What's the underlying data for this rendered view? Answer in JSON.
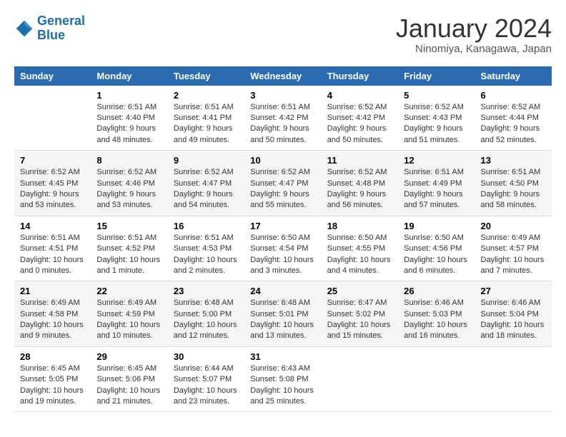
{
  "header": {
    "logo_line1": "General",
    "logo_line2": "Blue",
    "title": "January 2024",
    "subtitle": "Ninomiya, Kanagawa, Japan"
  },
  "columns": [
    "Sunday",
    "Monday",
    "Tuesday",
    "Wednesday",
    "Thursday",
    "Friday",
    "Saturday"
  ],
  "weeks": [
    [
      {
        "day": "",
        "info": ""
      },
      {
        "day": "1",
        "info": "Sunrise: 6:51 AM\nSunset: 4:40 PM\nDaylight: 9 hours\nand 48 minutes."
      },
      {
        "day": "2",
        "info": "Sunrise: 6:51 AM\nSunset: 4:41 PM\nDaylight: 9 hours\nand 49 minutes."
      },
      {
        "day": "3",
        "info": "Sunrise: 6:51 AM\nSunset: 4:42 PM\nDaylight: 9 hours\nand 50 minutes."
      },
      {
        "day": "4",
        "info": "Sunrise: 6:52 AM\nSunset: 4:42 PM\nDaylight: 9 hours\nand 50 minutes."
      },
      {
        "day": "5",
        "info": "Sunrise: 6:52 AM\nSunset: 4:43 PM\nDaylight: 9 hours\nand 51 minutes."
      },
      {
        "day": "6",
        "info": "Sunrise: 6:52 AM\nSunset: 4:44 PM\nDaylight: 9 hours\nand 52 minutes."
      }
    ],
    [
      {
        "day": "7",
        "info": "Sunrise: 6:52 AM\nSunset: 4:45 PM\nDaylight: 9 hours\nand 53 minutes."
      },
      {
        "day": "8",
        "info": "Sunrise: 6:52 AM\nSunset: 4:46 PM\nDaylight: 9 hours\nand 53 minutes."
      },
      {
        "day": "9",
        "info": "Sunrise: 6:52 AM\nSunset: 4:47 PM\nDaylight: 9 hours\nand 54 minutes."
      },
      {
        "day": "10",
        "info": "Sunrise: 6:52 AM\nSunset: 4:47 PM\nDaylight: 9 hours\nand 55 minutes."
      },
      {
        "day": "11",
        "info": "Sunrise: 6:52 AM\nSunset: 4:48 PM\nDaylight: 9 hours\nand 56 minutes."
      },
      {
        "day": "12",
        "info": "Sunrise: 6:51 AM\nSunset: 4:49 PM\nDaylight: 9 hours\nand 57 minutes."
      },
      {
        "day": "13",
        "info": "Sunrise: 6:51 AM\nSunset: 4:50 PM\nDaylight: 9 hours\nand 58 minutes."
      }
    ],
    [
      {
        "day": "14",
        "info": "Sunrise: 6:51 AM\nSunset: 4:51 PM\nDaylight: 10 hours\nand 0 minutes."
      },
      {
        "day": "15",
        "info": "Sunrise: 6:51 AM\nSunset: 4:52 PM\nDaylight: 10 hours\nand 1 minute."
      },
      {
        "day": "16",
        "info": "Sunrise: 6:51 AM\nSunset: 4:53 PM\nDaylight: 10 hours\nand 2 minutes."
      },
      {
        "day": "17",
        "info": "Sunrise: 6:50 AM\nSunset: 4:54 PM\nDaylight: 10 hours\nand 3 minutes."
      },
      {
        "day": "18",
        "info": "Sunrise: 6:50 AM\nSunset: 4:55 PM\nDaylight: 10 hours\nand 4 minutes."
      },
      {
        "day": "19",
        "info": "Sunrise: 6:50 AM\nSunset: 4:56 PM\nDaylight: 10 hours\nand 6 minutes."
      },
      {
        "day": "20",
        "info": "Sunrise: 6:49 AM\nSunset: 4:57 PM\nDaylight: 10 hours\nand 7 minutes."
      }
    ],
    [
      {
        "day": "21",
        "info": "Sunrise: 6:49 AM\nSunset: 4:58 PM\nDaylight: 10 hours\nand 9 minutes."
      },
      {
        "day": "22",
        "info": "Sunrise: 6:49 AM\nSunset: 4:59 PM\nDaylight: 10 hours\nand 10 minutes."
      },
      {
        "day": "23",
        "info": "Sunrise: 6:48 AM\nSunset: 5:00 PM\nDaylight: 10 hours\nand 12 minutes."
      },
      {
        "day": "24",
        "info": "Sunrise: 6:48 AM\nSunset: 5:01 PM\nDaylight: 10 hours\nand 13 minutes."
      },
      {
        "day": "25",
        "info": "Sunrise: 6:47 AM\nSunset: 5:02 PM\nDaylight: 10 hours\nand 15 minutes."
      },
      {
        "day": "26",
        "info": "Sunrise: 6:46 AM\nSunset: 5:03 PM\nDaylight: 10 hours\nand 16 minutes."
      },
      {
        "day": "27",
        "info": "Sunrise: 6:46 AM\nSunset: 5:04 PM\nDaylight: 10 hours\nand 18 minutes."
      }
    ],
    [
      {
        "day": "28",
        "info": "Sunrise: 6:45 AM\nSunset: 5:05 PM\nDaylight: 10 hours\nand 19 minutes."
      },
      {
        "day": "29",
        "info": "Sunrise: 6:45 AM\nSunset: 5:06 PM\nDaylight: 10 hours\nand 21 minutes."
      },
      {
        "day": "30",
        "info": "Sunrise: 6:44 AM\nSunset: 5:07 PM\nDaylight: 10 hours\nand 23 minutes."
      },
      {
        "day": "31",
        "info": "Sunrise: 6:43 AM\nSunset: 5:08 PM\nDaylight: 10 hours\nand 25 minutes."
      },
      {
        "day": "",
        "info": ""
      },
      {
        "day": "",
        "info": ""
      },
      {
        "day": "",
        "info": ""
      }
    ]
  ]
}
